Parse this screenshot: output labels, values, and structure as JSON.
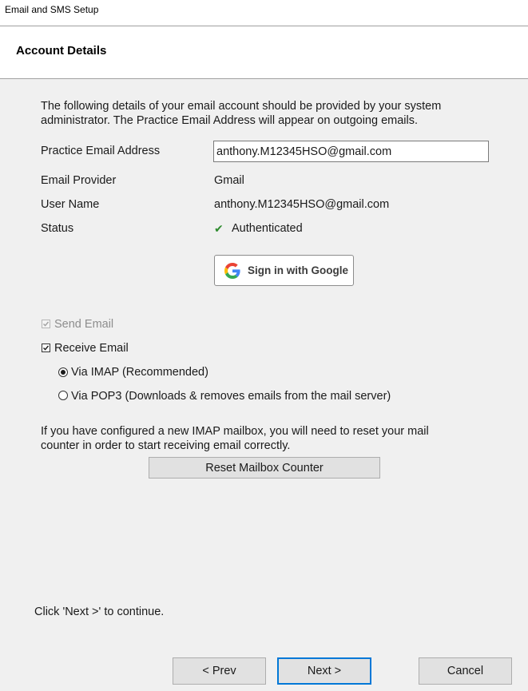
{
  "window": {
    "title": "Email and SMS Setup"
  },
  "header": {
    "title": "Account Details"
  },
  "intro_text": "The following details of your email account should be provided by your system administrator. The Practice Email Address will appear on outgoing emails.",
  "fields": {
    "practice_email": {
      "label": "Practice Email Address",
      "value": "anthony.M12345HSO@gmail.com"
    },
    "provider": {
      "label": "Email Provider",
      "value": "Gmail"
    },
    "user_name": {
      "label": "User Name",
      "value": "anthony.M12345HSO@gmail.com"
    },
    "status": {
      "label": "Status",
      "value": "Authenticated"
    }
  },
  "google_button": {
    "label": "Sign in with Google"
  },
  "options": {
    "send_email": {
      "label": "Send Email",
      "checked": true,
      "disabled": true
    },
    "receive_email": {
      "label": "Receive Email",
      "checked": true
    },
    "via_imap": {
      "label": "Via IMAP (Recommended)",
      "selected": true
    },
    "via_pop3": {
      "label": "Via POP3 (Downloads & removes emails from the mail server)",
      "selected": false
    }
  },
  "reset_note": "If you have configured a new IMAP mailbox, you will need to reset your mail counter in order to start receiving email correctly.",
  "reset_button": {
    "label": "Reset Mailbox Counter"
  },
  "continue_hint": "Click 'Next >' to continue.",
  "footer": {
    "prev_label": "< Prev",
    "next_label": "Next >",
    "cancel_label": "Cancel"
  },
  "colors": {
    "focus_blue": "#0078d7",
    "status_green": "#2e8b2e"
  }
}
